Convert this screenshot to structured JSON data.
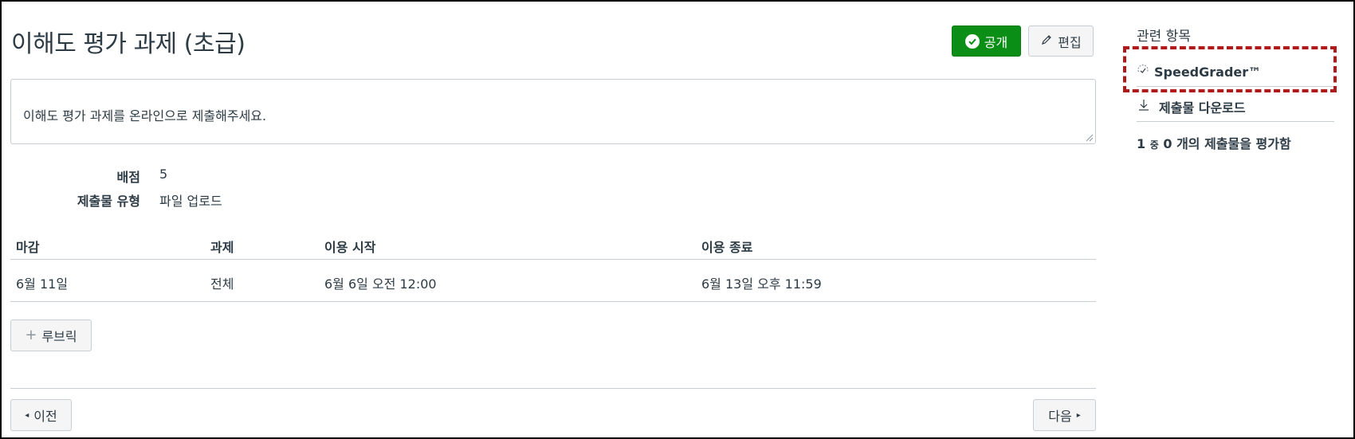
{
  "page": {
    "title": "이해도 평가 과제 (초급)",
    "publish_label": "공개",
    "edit_label": "편집",
    "description": "이해도 평가 과제를 온라인으로 제출해주세요."
  },
  "details": {
    "points_label": "배점",
    "points_value": "5",
    "submission_type_label": "제출물 유형",
    "submission_type_value": "파일 업로드"
  },
  "dates_table": {
    "headers": [
      "마감",
      "과제",
      "이용 시작",
      "이용 종료"
    ],
    "rows": [
      [
        "6월 11일",
        "전체",
        "6월 6일 오전 12:00",
        "6월 13일 오후 11:59"
      ]
    ]
  },
  "rubric": {
    "label": "루브릭"
  },
  "nav": {
    "prev_label": "이전",
    "next_label": "다음"
  },
  "sidebar": {
    "title": "관련 항목",
    "speedgrader_label": "SpeedGrader™",
    "download_label": "제출물 다운로드",
    "grade_status": {
      "count_total": "1",
      "of_word": "중",
      "count_graded": "0",
      "suffix": "개의 제출물을 평가함"
    }
  },
  "colors": {
    "publish_green": "#0b8e15",
    "highlight_red": "#b01a1a",
    "text": "#2d3b45",
    "border": "#c7cdd1"
  },
  "icons": {
    "publish": "check-circle-icon",
    "edit": "pencil-icon",
    "speedgrader": "speedgrader-icon",
    "download": "download-icon",
    "rubric": "plus-icon",
    "prev": "caret-left-icon",
    "next": "caret-right-icon"
  }
}
